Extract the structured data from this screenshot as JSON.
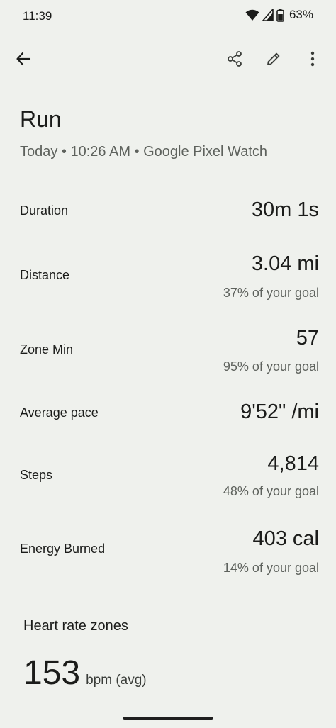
{
  "status_bar": {
    "time": "11:39",
    "battery": "63%",
    "icons": [
      "wifi-icon",
      "signal-icon",
      "battery-icon"
    ]
  },
  "app_bar": {
    "icons": [
      "back-arrow-icon",
      "share-icon",
      "edit-icon",
      "more-vert-icon"
    ]
  },
  "activity": {
    "title": "Run",
    "subtitle": "Today • 10:26 AM • Google Pixel Watch"
  },
  "metrics": {
    "duration": {
      "label": "Duration",
      "value": "30m 1s"
    },
    "distance": {
      "label": "Distance",
      "value": "3.04 mi",
      "goal": "37% of your goal"
    },
    "zone_min": {
      "label": "Zone Min",
      "value": "57",
      "goal": "95% of your goal"
    },
    "pace": {
      "label": "Average pace",
      "value": "9'52\" /mi"
    },
    "steps": {
      "label": "Steps",
      "value": "4,814",
      "goal": "48% of your goal"
    },
    "energy": {
      "label": "Energy Burned",
      "value": "403 cal",
      "goal": "14% of your goal"
    }
  },
  "heart_rate": {
    "heading": "Heart rate zones",
    "value": "153",
    "unit": "bpm (avg)"
  },
  "colors": {
    "background": "#eff1ed",
    "text_primary": "#1b1c1a",
    "text_secondary": "#5e625d"
  }
}
